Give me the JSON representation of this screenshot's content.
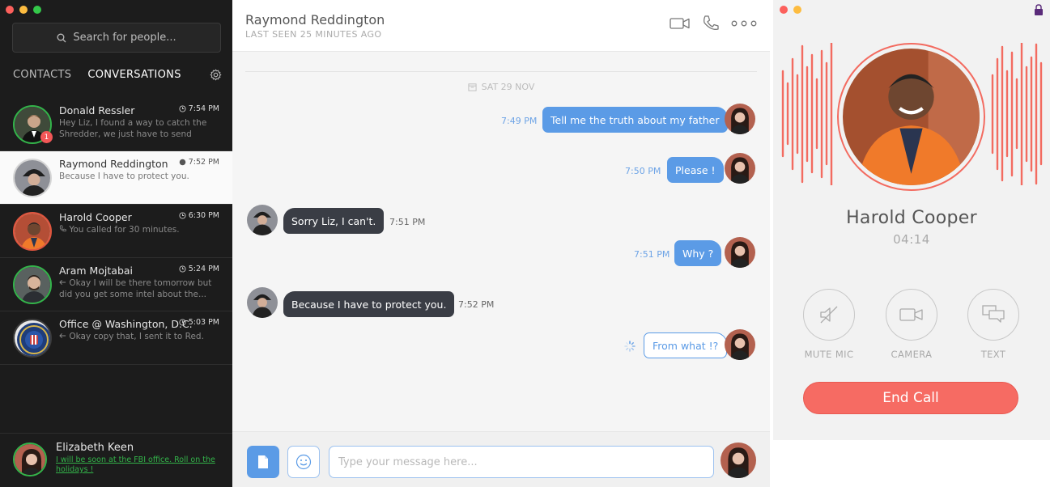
{
  "window": {
    "traffic_colors": [
      "#fc605c",
      "#fdbc40",
      "#34c84a"
    ]
  },
  "sidebar": {
    "search_placeholder": "Search for people...",
    "tabs": [
      {
        "label": "CONTACTS",
        "active": false
      },
      {
        "label": "CONVERSATIONS",
        "active": true
      }
    ],
    "conversations": [
      {
        "name": "Donald Ressler",
        "time": "7:54 PM",
        "preview": "Hey Liz, I found a way to catch the Shredder, we just have to send units...",
        "badge": "1",
        "status": "online",
        "avatar_icon": "person-avatar-icon"
      },
      {
        "name": "Raymond Reddington",
        "time": "7:52 PM",
        "preview": "Because I have to protect you.",
        "status": "offline",
        "selected": true,
        "avatar_icon": "person-avatar-icon"
      },
      {
        "name": "Harold Cooper",
        "time": "6:30 PM",
        "preview": "You called for 30 minutes.",
        "status": "in-call",
        "avatar_icon": "person-avatar-icon"
      },
      {
        "name": "Aram Mojtabai",
        "time": "5:24 PM",
        "preview": "Okay I will be there tomorrow but did you get some intel about the...",
        "status": "online",
        "avatar_icon": "person-avatar-icon"
      },
      {
        "name": "Office @ Washington, D.C.",
        "time": "5:03 PM",
        "preview": "Okay copy that, I sent it to Red.",
        "status": "offline",
        "avatar_icon": "fbi-seal-icon"
      }
    ],
    "me": {
      "name": "Elizabeth Keen",
      "status": "I will be soon at the FBI office. Roll on the holidays !"
    }
  },
  "chat": {
    "contact_name": "Raymond Reddington",
    "last_seen": "LAST SEEN 25 MINUTES AGO",
    "date": "SAT 29 NOV",
    "messages": [
      {
        "direction": "out",
        "text": "Tell me the truth about my father",
        "time": "7:49 PM"
      },
      {
        "direction": "out",
        "text": "Please !",
        "time": "7:50 PM"
      },
      {
        "direction": "in",
        "text": "Sorry Liz, I can't.",
        "time": "7:51 PM"
      },
      {
        "direction": "out",
        "text": "Why ?",
        "time": "7:51 PM"
      },
      {
        "direction": "in",
        "text": "Because I have to protect you.",
        "time": "7:52 PM"
      },
      {
        "direction": "out",
        "text": "From what !?",
        "time": "",
        "pending": true
      }
    ],
    "input_placeholder": "Type your message here..."
  },
  "call": {
    "caller": "Harold Cooper",
    "duration": "04:14",
    "controls": [
      {
        "label": "MUTE MIC",
        "icon": "mute-mic-icon"
      },
      {
        "label": "CAMERA",
        "icon": "camera-icon"
      },
      {
        "label": "TEXT",
        "icon": "chat-bubbles-icon"
      }
    ],
    "end_label": "End Call",
    "colors": {
      "accent": "#5b9be6",
      "call": "#f66b63",
      "online": "#33b44a"
    }
  }
}
